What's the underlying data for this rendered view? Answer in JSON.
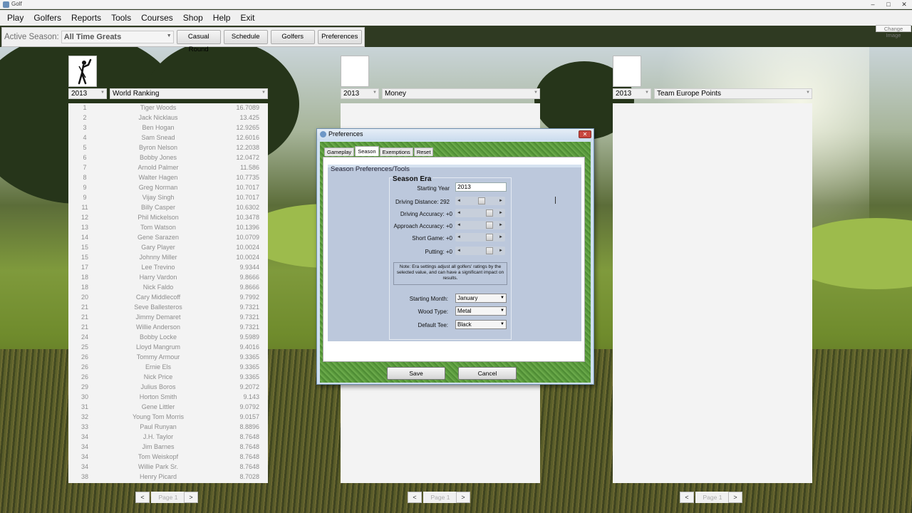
{
  "window": {
    "title": "Golf",
    "controls": [
      "–",
      "□",
      "✕"
    ]
  },
  "menu": [
    "Play",
    "Golfers",
    "Reports",
    "Tools",
    "Courses",
    "Shop",
    "Help",
    "Exit"
  ],
  "toolbar": {
    "season_label": "Active Season:",
    "season_value": "All Time Greats",
    "buttons": [
      "Casual Round",
      "Schedule",
      "Golfers",
      "Preferences"
    ]
  },
  "change_image_label": "Change Image",
  "panels": [
    {
      "year": "2013",
      "category": "World Ranking",
      "rows": [
        [
          "1",
          "Tiger Woods",
          "16.7089"
        ],
        [
          "2",
          "Jack Nicklaus",
          "13.425"
        ],
        [
          "3",
          "Ben Hogan",
          "12.9265"
        ],
        [
          "4",
          "Sam Snead",
          "12.6016"
        ],
        [
          "5",
          "Byron Nelson",
          "12.2038"
        ],
        [
          "6",
          "Bobby Jones",
          "12.0472"
        ],
        [
          "7",
          "Arnold Palmer",
          "11.586"
        ],
        [
          "8",
          "Walter Hagen",
          "10.7735"
        ],
        [
          "9",
          "Greg Norman",
          "10.7017"
        ],
        [
          "9",
          "Vijay Singh",
          "10.7017"
        ],
        [
          "11",
          "Billy Casper",
          "10.6302"
        ],
        [
          "12",
          "Phil Mickelson",
          "10.3478"
        ],
        [
          "13",
          "Tom Watson",
          "10.1396"
        ],
        [
          "14",
          "Gene Sarazen",
          "10.0709"
        ],
        [
          "15",
          "Gary Player",
          "10.0024"
        ],
        [
          "15",
          "Johnny Miller",
          "10.0024"
        ],
        [
          "17",
          "Lee Trevino",
          "9.9344"
        ],
        [
          "18",
          "Harry Vardon",
          "9.8666"
        ],
        [
          "18",
          "Nick Faldo",
          "9.8666"
        ],
        [
          "20",
          "Cary Middlecoff",
          "9.7992"
        ],
        [
          "21",
          "Seve Ballesteros",
          "9.7321"
        ],
        [
          "21",
          "Jimmy Demaret",
          "9.7321"
        ],
        [
          "21",
          "Willie Anderson",
          "9.7321"
        ],
        [
          "24",
          "Bobby Locke",
          "9.5989"
        ],
        [
          "25",
          "Lloyd Mangrum",
          "9.4016"
        ],
        [
          "26",
          "Tommy Armour",
          "9.3365"
        ],
        [
          "26",
          "Ernie Els",
          "9.3365"
        ],
        [
          "26",
          "Nick Price",
          "9.3365"
        ],
        [
          "29",
          "Julius Boros",
          "9.2072"
        ],
        [
          "30",
          "Horton Smith",
          "9.143"
        ],
        [
          "31",
          "Gene Littler",
          "9.0792"
        ],
        [
          "32",
          "Young Tom Morris",
          "9.0157"
        ],
        [
          "33",
          "Paul Runyan",
          "8.8896"
        ],
        [
          "34",
          "J.H. Taylor",
          "8.7648"
        ],
        [
          "34",
          "Jim Barnes",
          "8.7648"
        ],
        [
          "34",
          "Tom Weiskopf",
          "8.7648"
        ],
        [
          "34",
          "Willie Park Sr.",
          "8.7648"
        ],
        [
          "38",
          "Henry Picard",
          "8.7028"
        ]
      ],
      "page": "Page 1"
    },
    {
      "year": "2013",
      "category": "Money",
      "rows": [],
      "page": "Page 1"
    },
    {
      "year": "2013",
      "category": "Team Europe Points",
      "rows": [],
      "page": "Page 1"
    }
  ],
  "pager_prev": "<",
  "pager_next": ">",
  "dialog": {
    "title": "Preferences",
    "close": "✕",
    "tabs": [
      "Gameplay",
      "Season",
      "Exemptions",
      "Reset"
    ],
    "group_title": "Season Preferences/Tools",
    "era_title": "Season Era",
    "starting_year_label": "Starting Year",
    "starting_year_value": "2013",
    "sliders": [
      {
        "label": "Driving Distance: 292",
        "value": 0.5
      },
      {
        "label": "Driving Accuracy: +0",
        "value": 0.72
      },
      {
        "label": "Approach Accuracy: +0",
        "value": 0.72
      },
      {
        "label": "Short Game: +0",
        "value": 0.72
      },
      {
        "label": "Putting: +0",
        "value": 0.72
      }
    ],
    "note": "Note: Era settings adjust all golfers' ratings by the selected value, and can have a significant impact on results.",
    "starting_month_label": "Starting Month:",
    "starting_month_value": "January",
    "wood_type_label": "Wood Type:",
    "wood_type_value": "Metal",
    "default_tee_label": "Default Tee:",
    "default_tee_value": "Black",
    "save": "Save",
    "cancel": "Cancel"
  }
}
